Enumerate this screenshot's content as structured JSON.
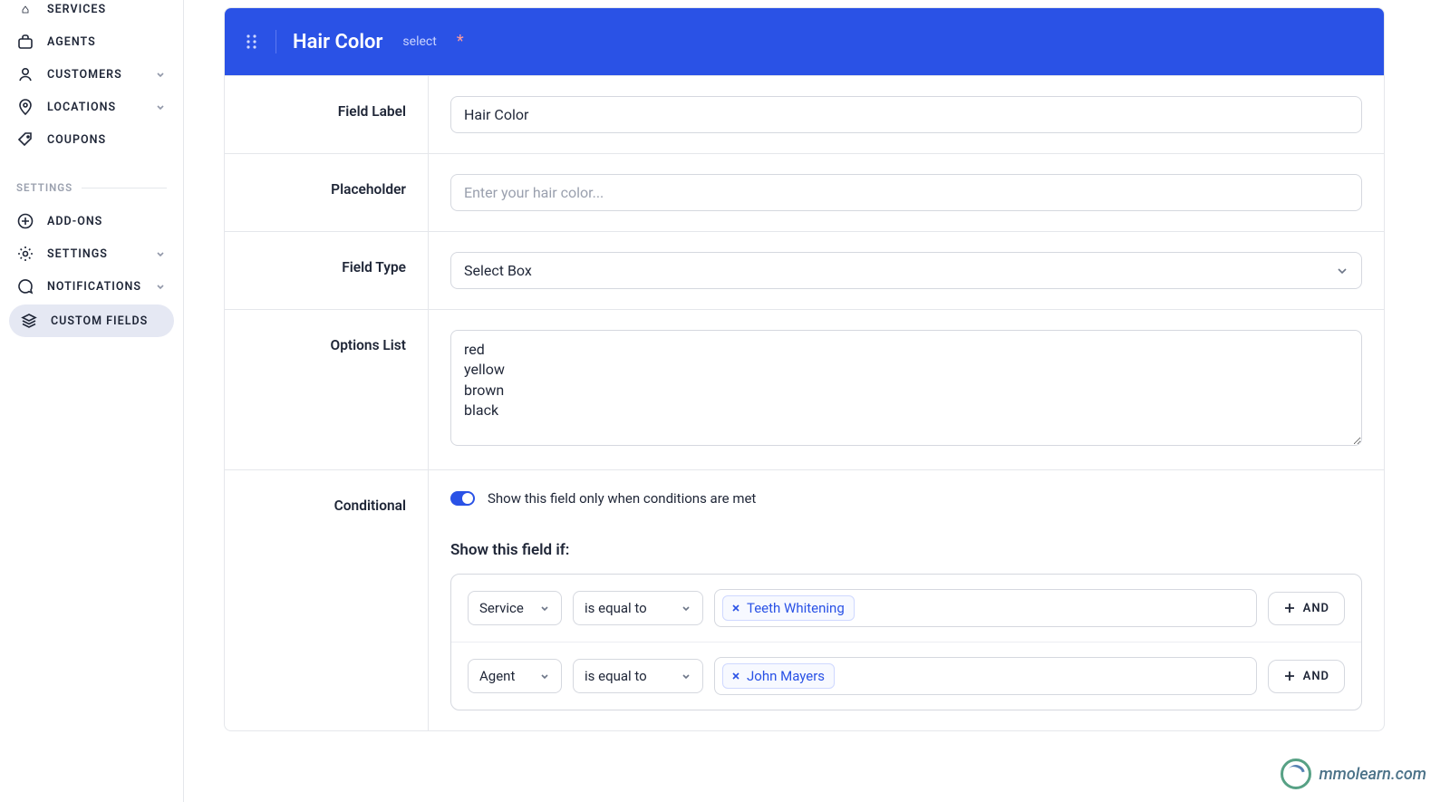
{
  "sidebar": {
    "nav": [
      {
        "label": "SERVICES"
      },
      {
        "label": "AGENTS"
      },
      {
        "label": "CUSTOMERS"
      },
      {
        "label": "LOCATIONS"
      },
      {
        "label": "COUPONS"
      }
    ],
    "settings_heading": "SETTINGS",
    "settings_nav": [
      {
        "label": "ADD-ONS"
      },
      {
        "label": "SETTINGS"
      },
      {
        "label": "NOTIFICATIONS"
      },
      {
        "label": "CUSTOM FIELDS"
      }
    ]
  },
  "panel": {
    "title": "Hair Color",
    "subtype": "select",
    "required_marker": "*"
  },
  "rows": {
    "field_label": {
      "label": "Field Label",
      "value": "Hair Color"
    },
    "placeholder": {
      "label": "Placeholder",
      "value": "",
      "placeholder": "Enter your hair color..."
    },
    "field_type": {
      "label": "Field Type",
      "value": "Select Box"
    },
    "options_list": {
      "label": "Options List",
      "value": "red\nyellow\nbrown\nblack"
    },
    "conditional": {
      "label": "Conditional",
      "toggle_label": "Show this field only when conditions are met",
      "section_title": "Show this field if:",
      "conditions": [
        {
          "attr": "Service",
          "op": "is equal to",
          "tag": "Teeth Whitening",
          "btn": "AND"
        },
        {
          "attr": "Agent",
          "op": "is equal to",
          "tag": "John Mayers",
          "btn": "AND"
        }
      ]
    }
  },
  "watermark": "mmolearn.com"
}
